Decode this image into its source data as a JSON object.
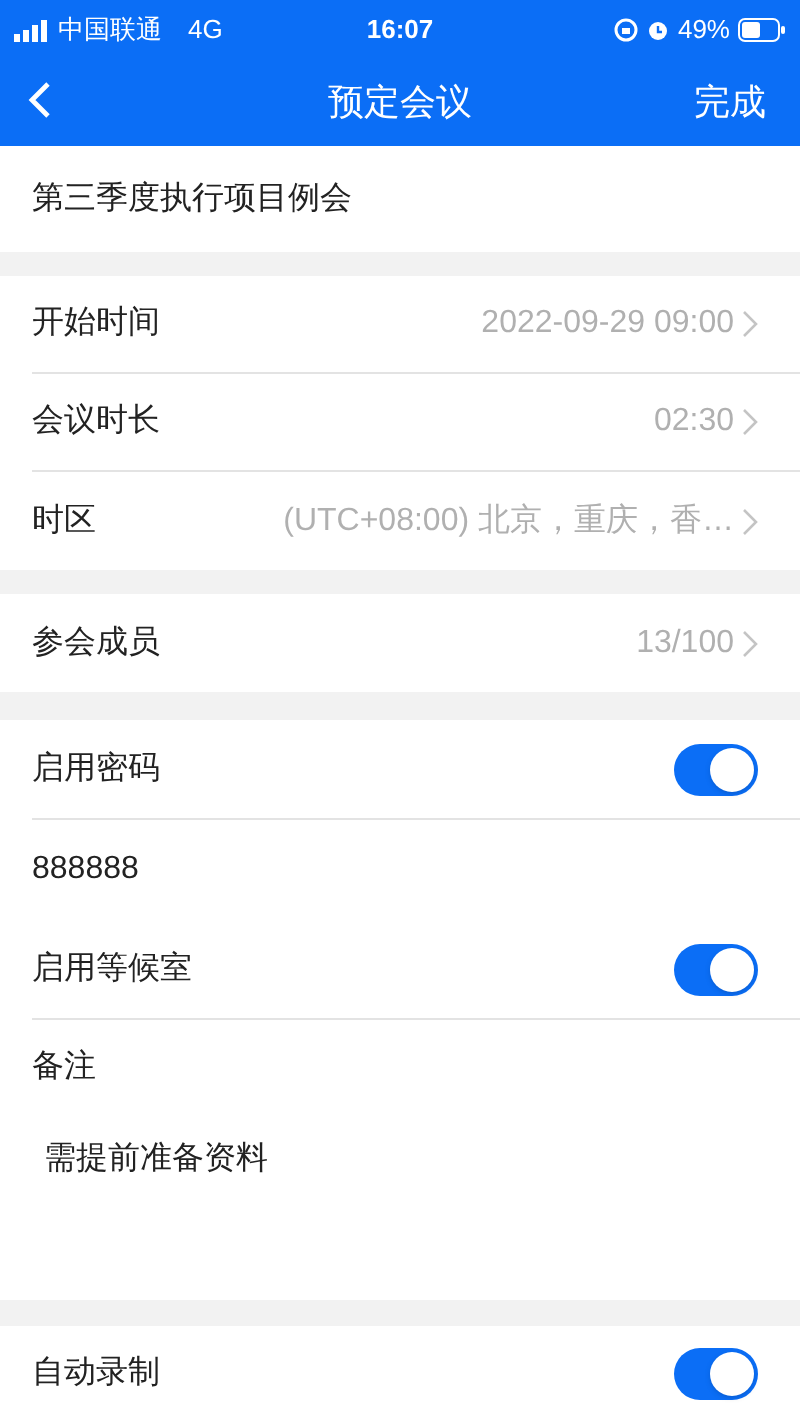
{
  "status_bar": {
    "carrier": "中国联通",
    "network": "4G",
    "time": "16:07",
    "battery": "49%"
  },
  "nav": {
    "title": "预定会议",
    "action": "完成"
  },
  "meeting_title": "第三季度执行项目例会",
  "sections": [
    [
      {
        "label": "开始时间",
        "value": "2022-09-29 09:00"
      },
      {
        "label": "会议时长",
        "value": "02:30"
      },
      {
        "label": "时区",
        "value": "(UTC+08:00) 北京，重庆，香…"
      }
    ],
    [
      {
        "label": "参会成员",
        "value": "13/100"
      }
    ]
  ],
  "password": {
    "label": "启用密码",
    "on": true,
    "value": "888888"
  },
  "waiting_room": {
    "label": "启用等候室",
    "on": true
  },
  "notes": {
    "label": "备注",
    "value": "需提前准备资料"
  },
  "auto_record": {
    "label": "自动录制",
    "on": true
  }
}
